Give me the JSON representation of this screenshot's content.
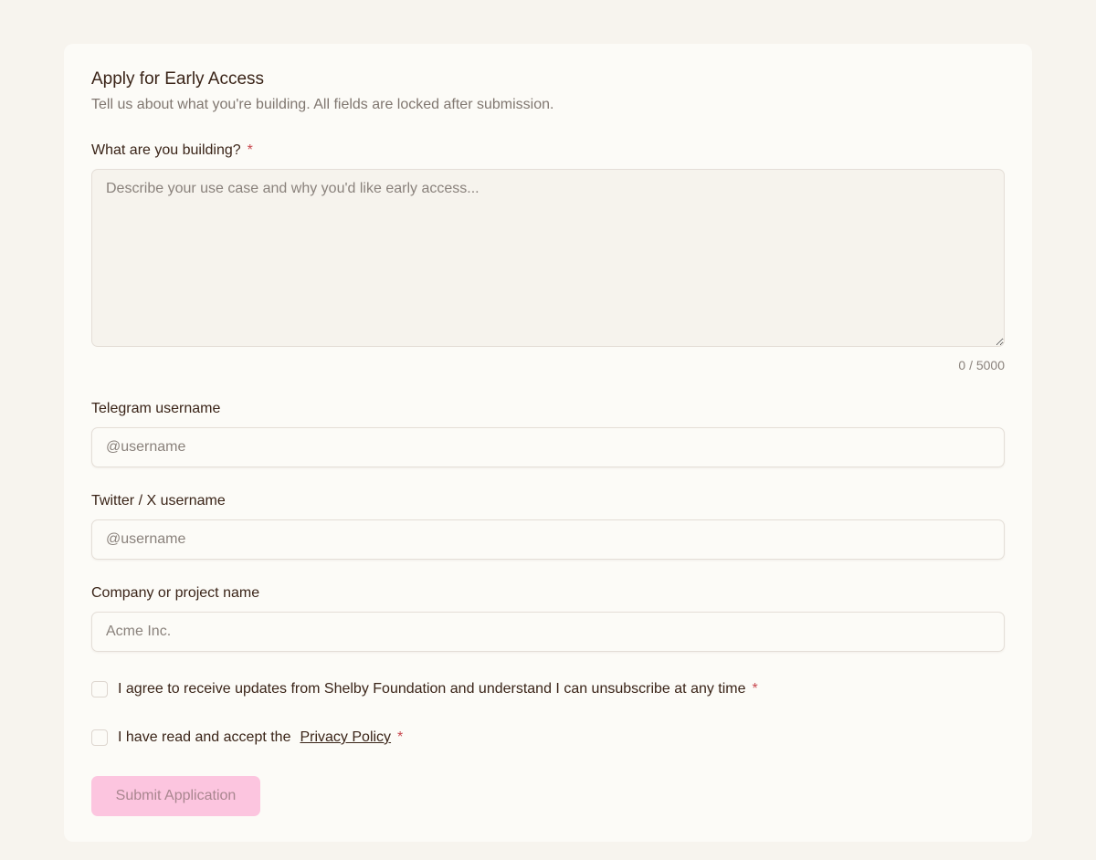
{
  "form": {
    "title": "Apply for Early Access",
    "subtitle": "Tell us about what you're building. All fields are locked after submission.",
    "required_mark": "*",
    "building": {
      "label": "What are you building?",
      "placeholder": "Describe your use case and why you'd like early access...",
      "value": "",
      "counter": "0 / 5000"
    },
    "telegram": {
      "label": "Telegram username",
      "placeholder": "@username",
      "value": ""
    },
    "twitter": {
      "label": "Twitter / X username",
      "placeholder": "@username",
      "value": ""
    },
    "company": {
      "label": "Company or project name",
      "placeholder": "Acme Inc.",
      "value": ""
    },
    "consent_updates": {
      "label": "I agree to receive updates from Shelby Foundation and understand I can unsubscribe at any time",
      "checked": false
    },
    "consent_privacy": {
      "label": "I have read and accept the",
      "link_text": "Privacy Policy",
      "checked": false
    },
    "submit_label": "Submit Application"
  },
  "colors": {
    "page_background": "#f7f4ee",
    "card_background": "#fcfbf7",
    "required_mark": "#c8484f",
    "submit_disabled_bg": "#fcc5df"
  }
}
